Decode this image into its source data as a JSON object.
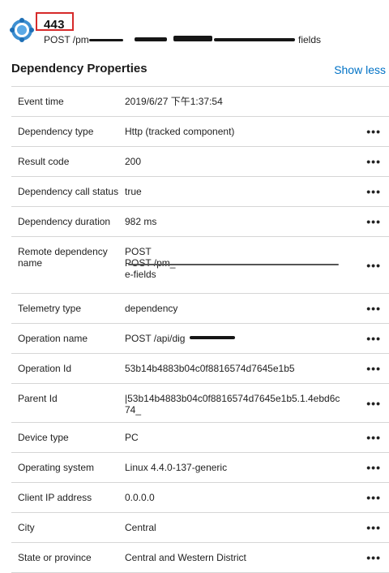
{
  "header": {
    "code": "443",
    "subtitle_left": "POST /pm",
    "subtitle_right": "fields"
  },
  "section": {
    "title": "Dependency Properties",
    "toggle_label": "Show less"
  },
  "properties": [
    {
      "label": "Event time",
      "value": "2019/6/27 下午1:37:54",
      "has_menu": false
    },
    {
      "label": "Dependency type",
      "value": "Http (tracked component)",
      "has_menu": true
    },
    {
      "label": "Result code",
      "value": "200",
      "has_menu": true
    },
    {
      "label": "Dependency call status",
      "value": "true",
      "has_menu": true
    },
    {
      "label": "Dependency duration",
      "value": "982 ms",
      "has_menu": true
    },
    {
      "label": "Remote dependency name",
      "value": "POST /pm_",
      "value_line3": "e-fields",
      "has_menu": true
    },
    {
      "label": "Telemetry type",
      "value": "dependency",
      "has_menu": true
    },
    {
      "label": "Operation name",
      "value": "POST /api/dig",
      "has_menu": true
    },
    {
      "label": "Operation Id",
      "value": "53b14b4883b04c0f8816574d7645e1b5",
      "has_menu": true
    },
    {
      "label": "Parent Id",
      "value": "|53b14b4883b04c0f8816574d7645e1b5.1.4ebd6c74_",
      "has_menu": true
    },
    {
      "label": "Device type",
      "value": "PC",
      "has_menu": true
    },
    {
      "label": "Operating system",
      "value": "Linux 4.4.0-137-generic",
      "has_menu": true
    },
    {
      "label": "Client IP address",
      "value": "0.0.0.0",
      "has_menu": true
    },
    {
      "label": "City",
      "value": "Central",
      "has_menu": true
    },
    {
      "label": "State or province",
      "value": "Central and Western District",
      "has_menu": true
    }
  ],
  "icons": {
    "app": "application-insights-icon",
    "menu": "more-options-icon"
  },
  "colors": {
    "accent": "#0072c6",
    "highlight_box": "#d62a2a",
    "divider": "#d6d6d6"
  }
}
